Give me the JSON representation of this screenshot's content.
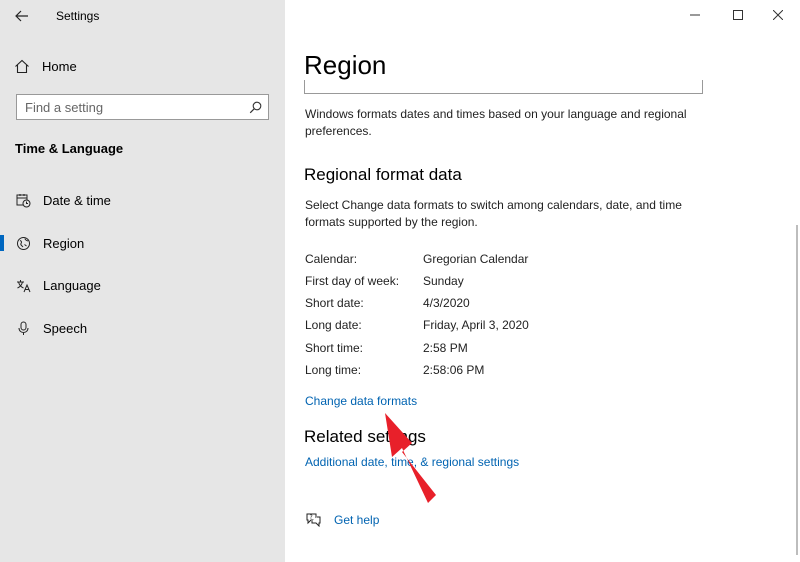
{
  "window": {
    "title": "Settings",
    "controls": {
      "minimize": "minimize-icon",
      "maximize": "maximize-icon",
      "close": "close-icon"
    }
  },
  "sidebar": {
    "home_label": "Home",
    "search_placeholder": "Find a setting",
    "section_title": "Time & Language",
    "items": [
      {
        "label": "Date & time",
        "icon": "clock-calendar-icon",
        "active": false
      },
      {
        "label": "Region",
        "icon": "globe-icon",
        "active": true
      },
      {
        "label": "Language",
        "icon": "language-icon",
        "active": false
      },
      {
        "label": "Speech",
        "icon": "microphone-icon",
        "active": false
      }
    ]
  },
  "main": {
    "page_title": "Region",
    "formats_description": "Windows formats dates and times based on your language and regional preferences.",
    "regional_format_heading": "Regional format data",
    "regional_format_description": "Select Change data formats to switch among calendars, date, and time formats supported by the region.",
    "format_rows": [
      {
        "key": "Calendar:",
        "value": "Gregorian Calendar"
      },
      {
        "key": "First day of week:",
        "value": "Sunday"
      },
      {
        "key": "Short date:",
        "value": "4/3/2020"
      },
      {
        "key": "Long date:",
        "value": "Friday, April 3, 2020"
      },
      {
        "key": "Short time:",
        "value": "2:58 PM"
      },
      {
        "key": "Long time:",
        "value": "2:58:06 PM"
      }
    ],
    "change_link": "Change data formats",
    "related_heading": "Related settings",
    "related_link": "Additional date, time, & regional settings",
    "help_label": "Get help"
  },
  "colors": {
    "accent": "#0063b1",
    "sidebar_bg": "#e6e6e6",
    "annotation_arrow": "#e8202a"
  }
}
